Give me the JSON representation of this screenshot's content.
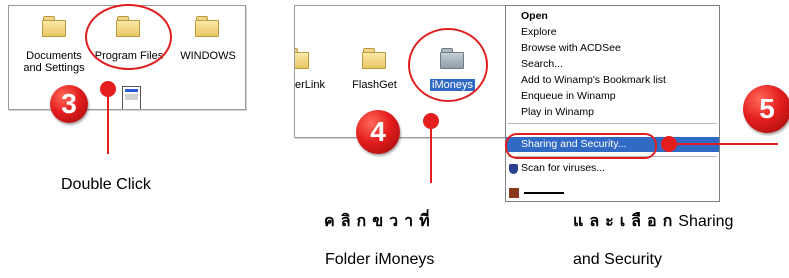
{
  "steps": [
    {
      "number": "3",
      "caption": "Double Click"
    },
    {
      "number": "4",
      "caption_line1": "คลิกขวาที่",
      "caption_line2": "Folder iMoneys"
    },
    {
      "number": "5",
      "caption_thai": "และเลือก",
      "caption_en": "Sharing",
      "caption_line2": "and Security"
    }
  ],
  "panel1": {
    "folders": [
      "Documents\nand Settings",
      "Program Files",
      "WINDOWS"
    ]
  },
  "panel2": {
    "folders": [
      "erLink",
      "FlashGet",
      "iMoneys"
    ]
  },
  "context_menu": {
    "items": [
      "Open",
      "Explore",
      "Browse with ACDSee",
      "Search...",
      "Add to Winamp's Bookmark list",
      "Enqueue in Winamp",
      "Play in Winamp",
      "Sharing and Security...",
      "Scan for viruses..."
    ],
    "highlighted": "Sharing and Security..."
  },
  "colors": {
    "accent": "#e41e1e",
    "highlight": "#316ac5"
  }
}
